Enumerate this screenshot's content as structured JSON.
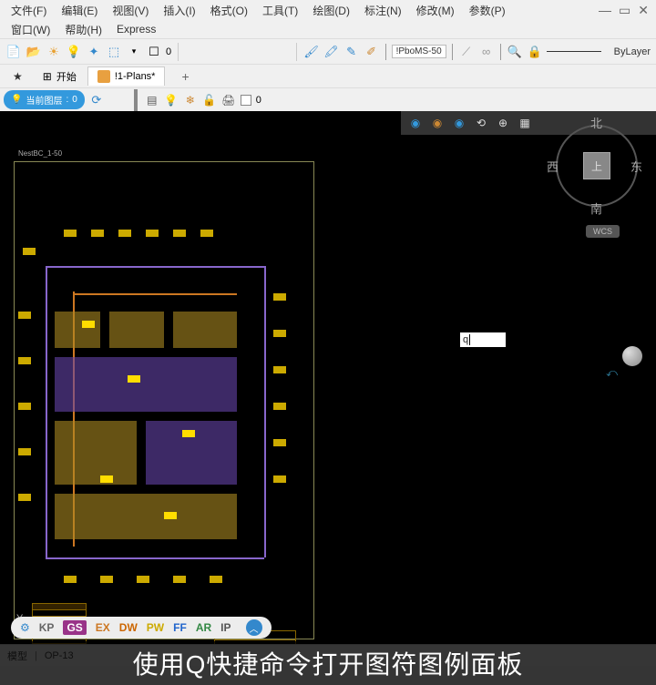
{
  "menu": {
    "file": "文件(F)",
    "edit": "编辑(E)",
    "view": "视图(V)",
    "insert": "插入(I)",
    "format": "格式(O)",
    "tools": "工具(T)",
    "draw": "绘图(D)",
    "annotate": "标注(N)",
    "modify": "修改(M)",
    "params": "参数(P)",
    "window": "窗口(W)",
    "help": "帮助(H)",
    "express": "Express"
  },
  "toolbar": {
    "linetype_name": "!PboMS-50",
    "bylayer": "ByLayer"
  },
  "tabs": {
    "start": "开始",
    "plans": "!1-Plans*"
  },
  "layerbar": {
    "current_label": "当前图层",
    "current_value": "0",
    "layer_value": "0"
  },
  "canvas": {
    "drawing_title": "NestBC_1-50",
    "compass": {
      "n": "北",
      "s": "南",
      "e": "东",
      "w": "西",
      "top": "上"
    },
    "wcs": "WCS",
    "command_input": "q",
    "y_label": "Y"
  },
  "cmdbar": {
    "tokens": [
      "KP",
      "GS",
      "EX",
      "DW",
      "PW",
      "FF",
      "AR",
      "IP"
    ]
  },
  "statusbar": {
    "model": "模型",
    "op": "OP-13"
  },
  "caption": "使用Q快捷命令打开图符图例面板"
}
